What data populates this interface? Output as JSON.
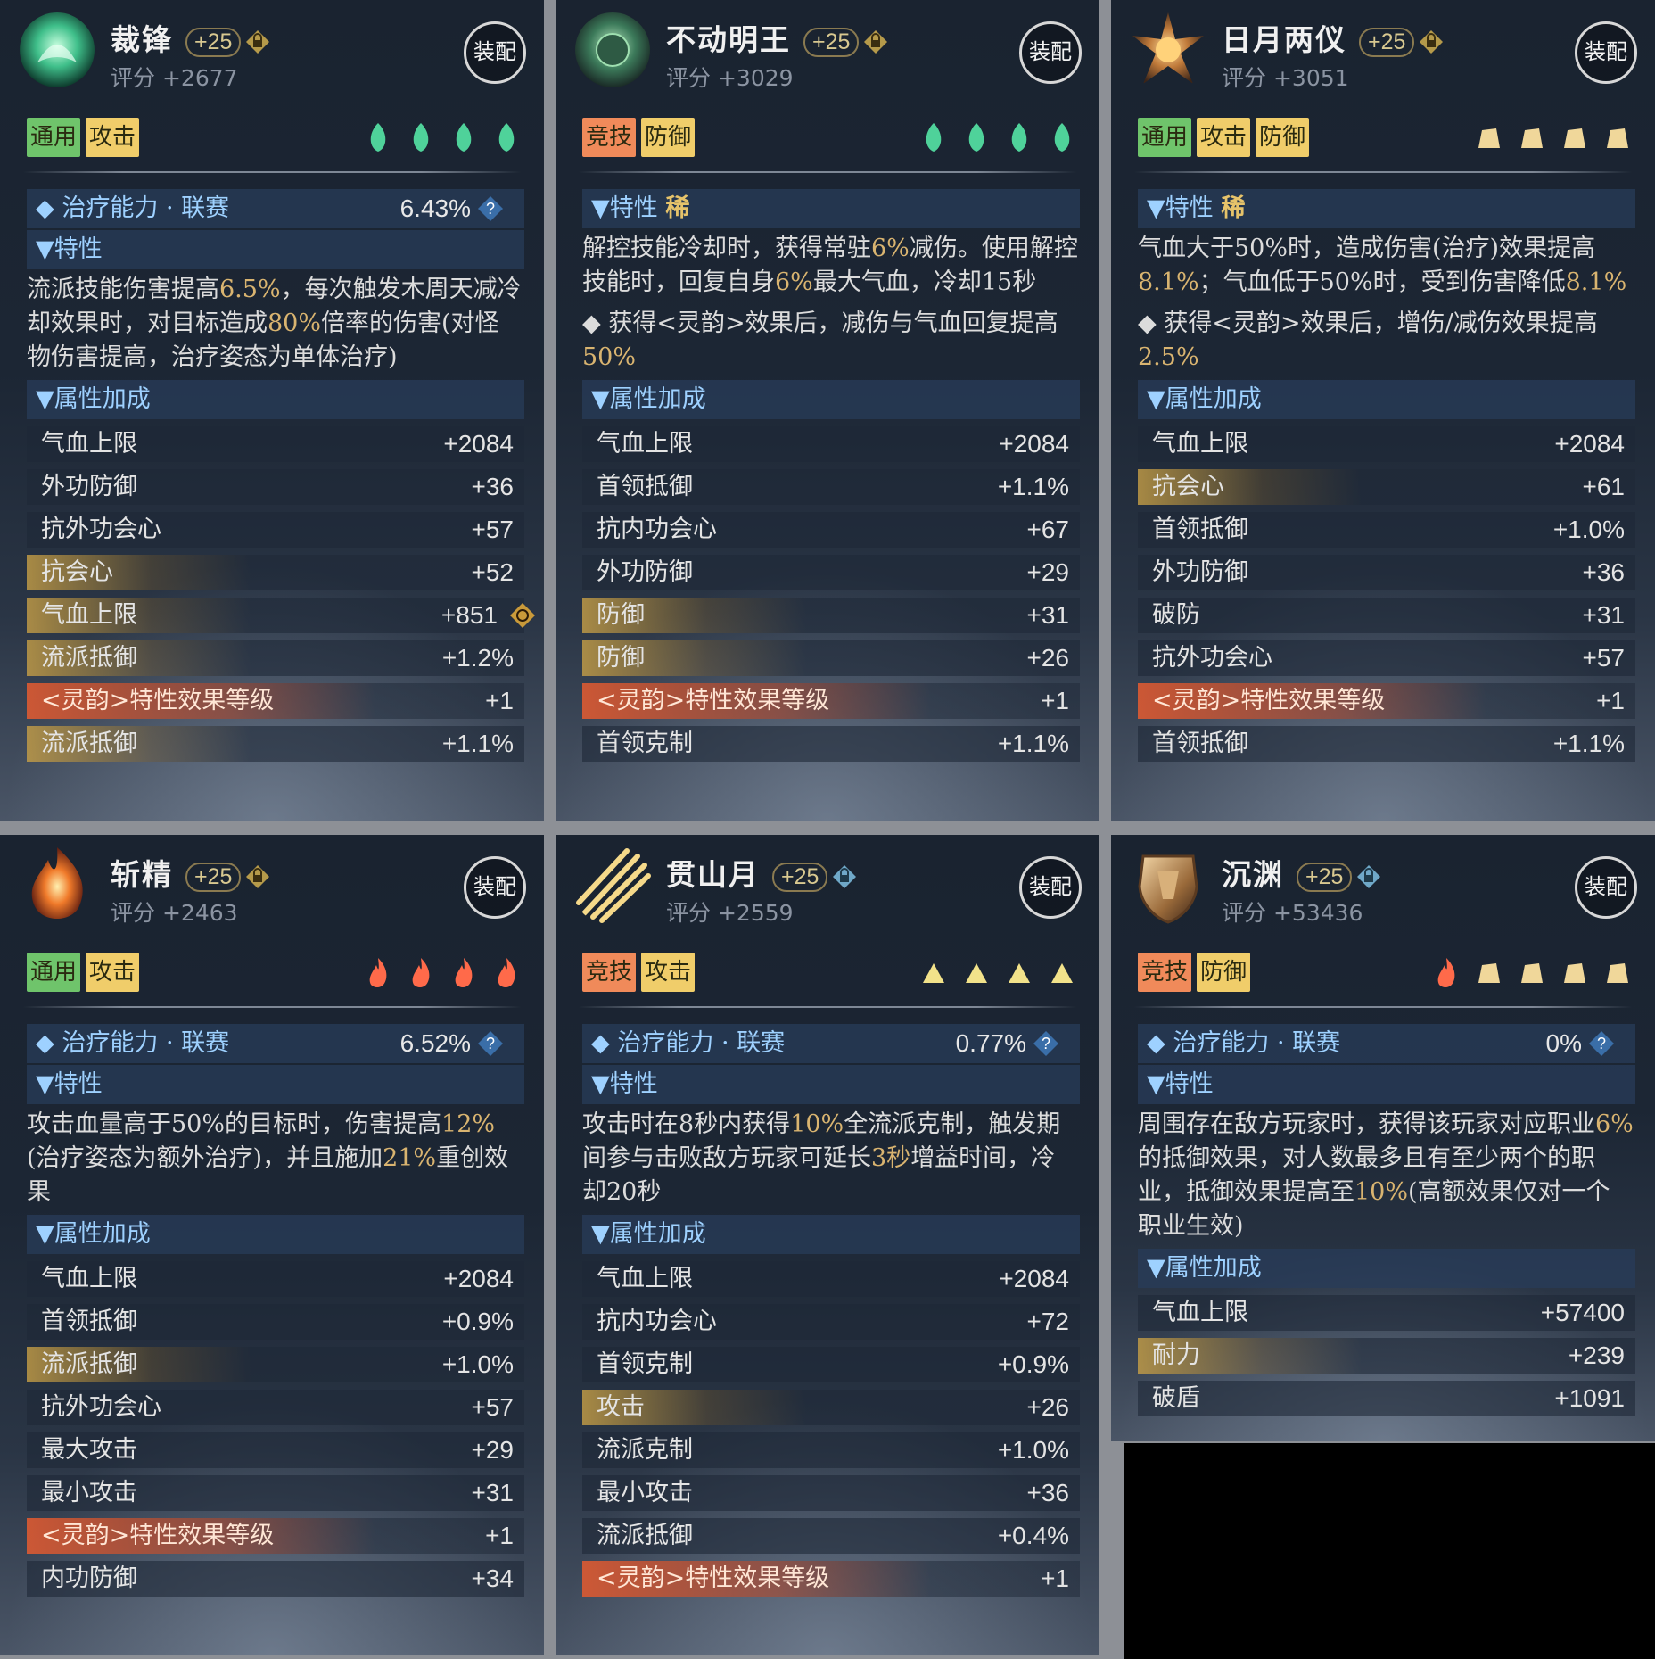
{
  "equip_label": "装配",
  "score_prefix": "评分",
  "sections": {
    "traits": "特性",
    "attrs": "属性加成",
    "rare": "稀"
  },
  "cards": [
    {
      "name": "裁锋",
      "level": "+25",
      "score": "+2677",
      "tags": [
        "通用",
        "攻击"
      ],
      "heal_label": "治疗能力 · 联赛",
      "heal_value": "6.43%",
      "desc": [
        {
          "t": "流派技能伤害提高"
        },
        {
          "t": "6.5%",
          "hl": true
        },
        {
          "t": "，每次触发木周天减冷却效果时，对目标造成"
        },
        {
          "t": "80%",
          "hl": true
        },
        {
          "t": "倍率的伤害(对怪物伤害提高，治疗姿态为单体治疗)"
        }
      ],
      "stats": [
        {
          "k": "气血上限",
          "v": "+2084"
        },
        {
          "k": "外功防御",
          "v": "+36"
        },
        {
          "k": "抗外功会心",
          "v": "+57"
        },
        {
          "k": "抗会心",
          "v": "+52",
          "gold": true
        },
        {
          "k": "气血上限",
          "v": "+851",
          "gold": true,
          "icon": true
        },
        {
          "k": "流派抵御",
          "v": "+1.2%",
          "gold": true
        },
        {
          "k": "<灵韵>特性效果等级",
          "v": "+1",
          "red": true
        },
        {
          "k": "流派抵御",
          "v": "+1.1%",
          "gold": true
        }
      ]
    },
    {
      "name": "不动明王",
      "level": "+25",
      "score": "+3029",
      "tags": [
        "竞技",
        "防御"
      ],
      "desc": [
        {
          "t": "解控技能冷却时，获得常驻"
        },
        {
          "t": "6%",
          "hl": true
        },
        {
          "t": "减伤。使用解控技能时，回复自身"
        },
        {
          "t": "6%",
          "hl": true
        },
        {
          "t": "最大气血，冷却15秒"
        }
      ],
      "desc2": [
        {
          "t": "◆ 获得<灵韵>效果后，减伤与气血回复提高"
        },
        {
          "t": "50%",
          "hl": true
        }
      ],
      "stats": [
        {
          "k": "气血上限",
          "v": "+2084"
        },
        {
          "k": "首领抵御",
          "v": "+1.1%"
        },
        {
          "k": "抗内功会心",
          "v": "+67"
        },
        {
          "k": "外功防御",
          "v": "+29"
        },
        {
          "k": "防御",
          "v": "+31",
          "gold": true
        },
        {
          "k": "防御",
          "v": "+26",
          "gold": true
        },
        {
          "k": "<灵韵>特性效果等级",
          "v": "+1",
          "red": true
        },
        {
          "k": "首领克制",
          "v": "+1.1%"
        }
      ]
    },
    {
      "name": "日月两仪",
      "level": "+25",
      "score": "+3051",
      "tags": [
        "通用",
        "攻击",
        "防御"
      ],
      "desc": [
        {
          "t": "气血大于50%时，造成伤害(治疗)效果提高"
        },
        {
          "t": "8.1%",
          "hl": true
        },
        {
          "t": "；气血低于50%时，受到伤害降低"
        },
        {
          "t": "8.1%",
          "hl": true
        }
      ],
      "desc2": [
        {
          "t": "◆ 获得<灵韵>效果后，增伤/减伤效果提高"
        },
        {
          "t": "2.5%",
          "hl": true
        }
      ],
      "stats": [
        {
          "k": "气血上限",
          "v": "+2084"
        },
        {
          "k": "抗会心",
          "v": "+61",
          "gold": true
        },
        {
          "k": "首领抵御",
          "v": "+1.0%"
        },
        {
          "k": "外功防御",
          "v": "+36"
        },
        {
          "k": "破防",
          "v": "+31"
        },
        {
          "k": "抗外功会心",
          "v": "+57"
        },
        {
          "k": "<灵韵>特性效果等级",
          "v": "+1",
          "red": true
        },
        {
          "k": "首领抵御",
          "v": "+1.1%"
        }
      ]
    },
    {
      "name": "斩精",
      "level": "+25",
      "score": "+2463",
      "tags": [
        "通用",
        "攻击"
      ],
      "heal_label": "治疗能力 · 联赛",
      "heal_value": "6.52%",
      "desc": [
        {
          "t": "攻击血量高于50%的目标时，伤害提高"
        },
        {
          "t": "12%",
          "hl": true
        },
        {
          "t": "(治疗姿态为额外治疗)，并且施加"
        },
        {
          "t": "21%",
          "hl": true
        },
        {
          "t": "重创效果"
        }
      ],
      "stats": [
        {
          "k": "气血上限",
          "v": "+2084"
        },
        {
          "k": "首领抵御",
          "v": "+0.9%"
        },
        {
          "k": "流派抵御",
          "v": "+1.0%",
          "gold": true
        },
        {
          "k": "抗外功会心",
          "v": "+57"
        },
        {
          "k": "最大攻击",
          "v": "+29"
        },
        {
          "k": "最小攻击",
          "v": "+31"
        },
        {
          "k": "<灵韵>特性效果等级",
          "v": "+1",
          "red": true
        },
        {
          "k": "内功防御",
          "v": "+34"
        }
      ]
    },
    {
      "name": "贯山月",
      "level": "+25",
      "score": "+2559",
      "tags": [
        "竞技",
        "攻击"
      ],
      "heal_label": "治疗能力 · 联赛",
      "heal_value": "0.77%",
      "desc": [
        {
          "t": "攻击时在8秒内获得"
        },
        {
          "t": "10%",
          "hl": true
        },
        {
          "t": "全流派克制，触发期间参与击败敌方玩家可延长"
        },
        {
          "t": "3秒",
          "hl": true
        },
        {
          "t": "增益时间，冷却20秒"
        }
      ],
      "stats": [
        {
          "k": "气血上限",
          "v": "+2084"
        },
        {
          "k": "抗内功会心",
          "v": "+72"
        },
        {
          "k": "首领克制",
          "v": "+0.9%"
        },
        {
          "k": "攻击",
          "v": "+26",
          "gold": true
        },
        {
          "k": "流派克制",
          "v": "+1.0%"
        },
        {
          "k": "最小攻击",
          "v": "+36"
        },
        {
          "k": "流派抵御",
          "v": "+0.4%"
        },
        {
          "k": "<灵韵>特性效果等级",
          "v": "+1",
          "red": true
        }
      ]
    },
    {
      "name": "沉渊",
      "level": "+25",
      "score": "+53436",
      "tags": [
        "竞技",
        "防御"
      ],
      "heal_label": "治疗能力 · 联赛",
      "heal_value": "0%",
      "desc": [
        {
          "t": "周围存在敌方玩家时，获得该玩家对应职业"
        },
        {
          "t": "6%",
          "hl": true
        },
        {
          "t": "的抵御效果，对人数最多且有至少两个的职业，抵御效果提高至"
        },
        {
          "t": "10%",
          "hl": true
        },
        {
          "t": "(高额效果仅对一个职业生效)"
        }
      ],
      "stats": [
        {
          "k": "气血上限",
          "v": "+57400"
        },
        {
          "k": "耐力",
          "v": "+239",
          "gold": true
        },
        {
          "k": "破盾",
          "v": "+1091"
        }
      ]
    }
  ]
}
